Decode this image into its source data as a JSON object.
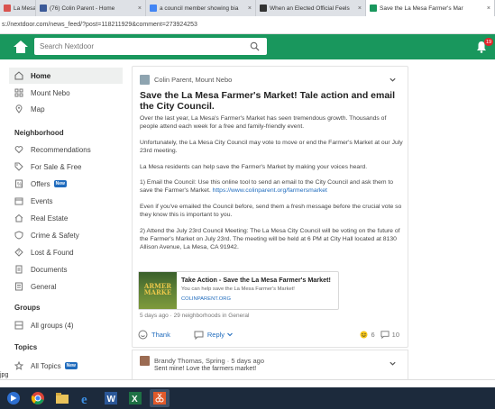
{
  "browser": {
    "tabs": [
      {
        "title": "La Mesa F",
        "color": "#d9534f"
      },
      {
        "title": "(76) Colin Parent - Home",
        "color": "#3b5998"
      },
      {
        "title": "a council member showing bia",
        "color": "#4285f4"
      },
      {
        "title": "When an Elected Official Feels",
        "color": "#333333"
      },
      {
        "title": "Save the La Mesa Farmer's Mar",
        "color": "#19975d"
      }
    ],
    "url": "s://nextdoor.com/news_feed/?post=118211929&comment=273924253"
  },
  "header": {
    "search_placeholder": "Search Nextdoor",
    "notification_count": "19"
  },
  "sidebar": {
    "top": [
      {
        "label": "Home",
        "icon": "home-icon"
      },
      {
        "label": "Mount Nebo",
        "icon": "neighborhood-icon"
      },
      {
        "label": "Map",
        "icon": "map-pin-icon"
      }
    ],
    "neighborhood_heading": "Neighborhood",
    "neighborhood": [
      {
        "label": "Recommendations",
        "icon": "heart-icon"
      },
      {
        "label": "For Sale & Free",
        "icon": "tag-icon"
      },
      {
        "label": "Offers",
        "icon": "offers-icon",
        "badge": "New"
      },
      {
        "label": "Events",
        "icon": "calendar-icon"
      },
      {
        "label": "Real Estate",
        "icon": "house-icon"
      },
      {
        "label": "Crime & Safety",
        "icon": "shield-icon"
      },
      {
        "label": "Lost & Found",
        "icon": "question-icon"
      },
      {
        "label": "Documents",
        "icon": "document-icon"
      },
      {
        "label": "General",
        "icon": "list-icon"
      }
    ],
    "groups_heading": "Groups",
    "groups": [
      {
        "label": "All groups (4)",
        "icon": "groups-icon"
      }
    ],
    "topics_heading": "Topics",
    "topics": [
      {
        "label": "All Topics",
        "icon": "topics-icon",
        "badge": "New"
      }
    ]
  },
  "post": {
    "author": "Colin Parent, Mount Nebo",
    "title": "Save the La Mesa Farmer's Market! Tale action and email the City Council.",
    "paragraphs": [
      "Over the last year, La Mesa's Farmer's Market has seen tremendous growth. Thousands of people attend each week for a free and family-friendly event.",
      "Unfortunately, the La Mesa City Council may vote to move or end the Farmer's Market at our July 23rd meeting.",
      "La Mesa residents can help save the Farmer's Market by making your voices heard.",
      "1) Email the Council: Use this online tool to send an email to the City Council and ask them to save the Farmer's Market.",
      "Even if you've emailed the Council before, send them a fresh message before the crucial vote so they know this is important to you.",
      "2) Attend the July 23rd Council Meeting: The La Mesa City Council will be voting on the future of the Farmer's Market on July 23rd. The meeting will be held at 6 PM at City Hall located at 8130 Allison Avenue, La Mesa, CA 91942."
    ],
    "link": "https://www.colinparent.org/farmersmarket",
    "card": {
      "title": "Take Action - Save the La Mesa Farmer's Market!",
      "subtitle": "You can help save the La Mesa Farmer's Market!",
      "domain": "COLINPARENT.ORG",
      "thumb_text": "ARMER MARKE"
    },
    "meta": "5 days ago · 29 neighborhoods in General",
    "thank_label": "Thank",
    "reply_label": "Reply",
    "thanks_count": "6",
    "reply_count": "10"
  },
  "post2": {
    "author": "Brandy Thomas, Spring · 5 days ago",
    "snippet": "Sent mine! Love the farmers market!"
  },
  "downloads": {
    "file": "jpg"
  }
}
